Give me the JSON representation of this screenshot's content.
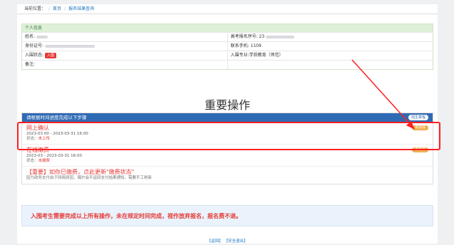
{
  "breadcrumb": {
    "current_label": "当前位置：",
    "home": "首页",
    "page": "报名结果查询"
  },
  "info": {
    "header": "个人信息",
    "rows": [
      {
        "left": "姓名:",
        "right": "高考报名序号: 23"
      },
      {
        "left": "身份证号: ",
        "right": "联系手机: 1109"
      },
      {
        "left": "入围状态: ",
        "right": "入围专业:学前教育（师范）"
      },
      {
        "left": "备注:",
        "right": ""
      }
    ],
    "status_badge": "入围"
  },
  "title": "重要操作",
  "steps": {
    "header": "请根据时间进度完成以下步骤",
    "guide_button": "招生章程",
    "items": [
      {
        "name": "网上确认",
        "time": "2023-03 00 - 2023-03-31 16:00",
        "status_label": "状态：",
        "status": "未上传",
        "badge": "未完成"
      },
      {
        "name": "在线缴费",
        "time": "2023-03 - 2023-03-31 16:00",
        "status_label": "状态：",
        "status": "未缴费",
        "badge": "未完成"
      }
    ],
    "notice_title": "【重要】如你已缴费，点此更新\"缴费状态\"",
    "notice_text": "因为政务支付由于网络原因，偶尔会不返回支付结果通知，需要手工刷新"
  },
  "warning": "入围考生需要完成以上所有操作，未在规定时间完成，视作放弃报名，报名费不退。",
  "footer": {
    "back": "【返回】",
    "logout": "【安全退出】"
  },
  "colors": {
    "accent": "#2f6ab4",
    "red": "#e53935",
    "highlight": "#ff2020"
  }
}
